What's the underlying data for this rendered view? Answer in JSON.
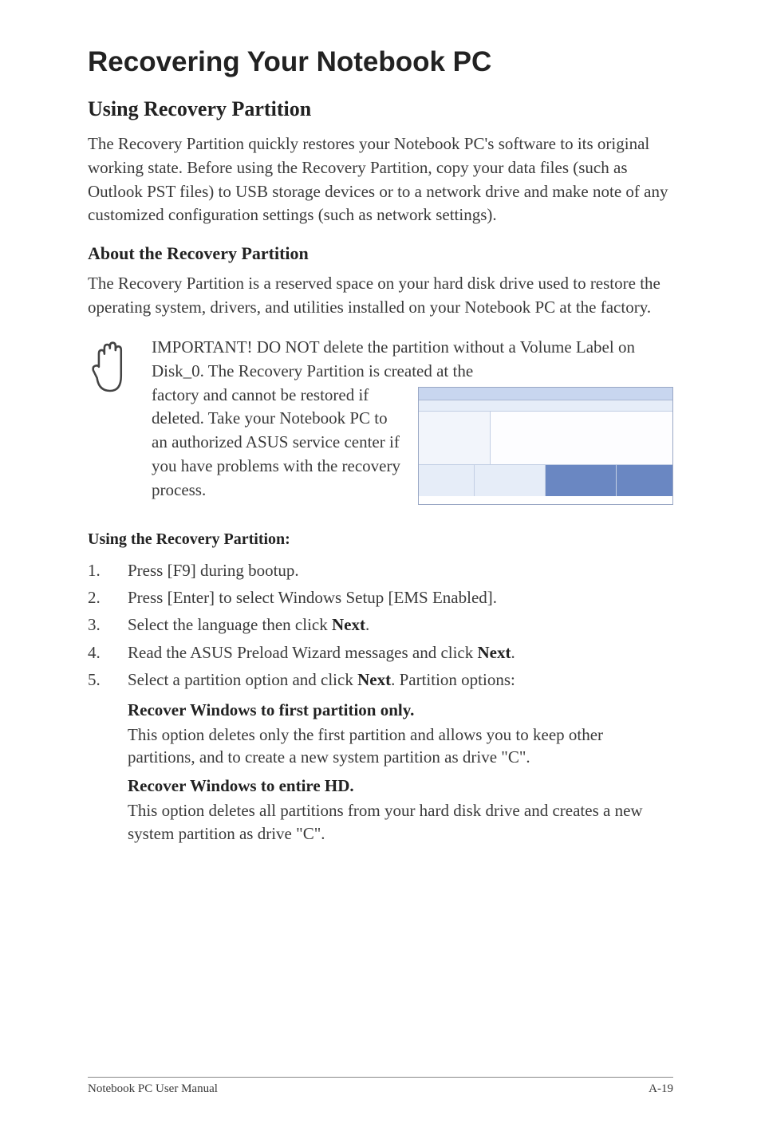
{
  "title": "Recovering Your Notebook PC",
  "h2": "Using Recovery Partition",
  "intro": "The Recovery Partition quickly restores your Notebook PC's software to its original working state. Before using the Recovery Partition, copy your data files (such as Outlook PST files) to USB storage devices or to a network drive and make note of any customized configuration settings (such as network settings).",
  "h3": "About the Recovery Partition",
  "about": "The Recovery Partition is a reserved space on your hard disk drive used to restore the operating system, drivers, and utilities installed on your Notebook PC at the factory.",
  "note_line1": "IMPORTANT! DO NOT delete the partition without a Volume Label on Disk_0. The Recovery Partition is created at the ",
  "note_left": "factory and cannot be restored if deleted. Take your Notebook PC to an authorized ASUS service center if you have problems with the recovery process.",
  "h4": "Using the Recovery Partition:",
  "steps": {
    "s1": "Press [F9] during bootup.",
    "s2": "Press [Enter] to select Windows Setup [EMS Enabled].",
    "s3_a": "Select the language then click ",
    "s3_b": "Next",
    "s3_c": ".",
    "s4_a": "Read the ASUS Preload Wizard messages and click ",
    "s4_b": "Next",
    "s4_c": ".",
    "s5_a": "Select a partition option and click ",
    "s5_b": "Next",
    "s5_c": ". Partition options:"
  },
  "opt1_title": "Recover Windows to first partition only.",
  "opt1_desc": "This option deletes only the first partition and allows you to keep other partitions, and to create a new system partition as drive \"C\".",
  "opt2_title": "Recover Windows to entire HD.",
  "opt2_desc": "This option deletes all partitions from your hard disk drive and creates a new system partition as drive \"C\".",
  "footer_left": "Notebook PC User Manual",
  "footer_right": "A-19"
}
